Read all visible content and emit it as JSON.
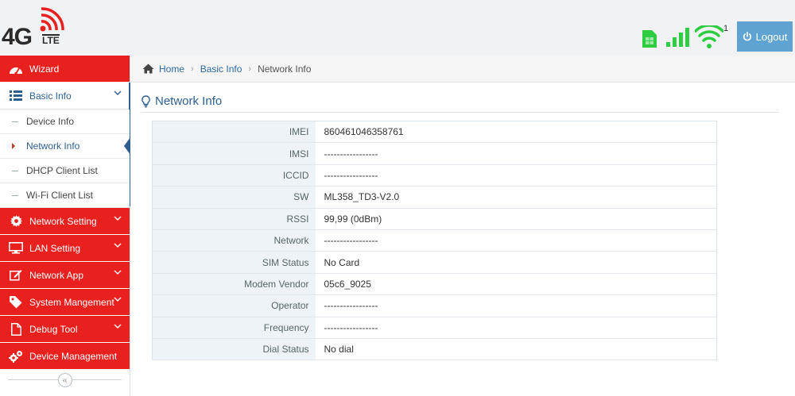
{
  "header": {
    "logo": {
      "text_4g": "4G",
      "text_lte": "LTE"
    },
    "wifi_clients": "1",
    "logout_label": "Logout",
    "colors": {
      "status_green": "#2ecc40",
      "logout_bg": "#5fa3d3",
      "brand_red": "#e8201e"
    }
  },
  "sidebar": {
    "items": [
      {
        "label": "Wizard",
        "icon": "dashboard-icon"
      },
      {
        "label": "Basic Info",
        "icon": "list-icon",
        "open": true,
        "subitems": [
          {
            "label": "Device Info"
          },
          {
            "label": "Network Info",
            "active": true
          },
          {
            "label": "DHCP Client List"
          },
          {
            "label": "Wi-Fi Client List"
          }
        ]
      },
      {
        "label": "Network Setting",
        "icon": "gear-icon"
      },
      {
        "label": "LAN Setting",
        "icon": "monitor-icon"
      },
      {
        "label": "Network App",
        "icon": "edit-icon"
      },
      {
        "label": "System Mangement",
        "icon": "tag-icon"
      },
      {
        "label": "Debug Tool",
        "icon": "file-icon"
      },
      {
        "label": "Device Management",
        "icon": "gears-icon"
      }
    ],
    "collapse_label": "«"
  },
  "breadcrumb": {
    "home": "Home",
    "section": "Basic Info",
    "current": "Network Info"
  },
  "page": {
    "title": "Network Info"
  },
  "network_info": {
    "rows": [
      {
        "label": "IMEI",
        "value": "860461046358761"
      },
      {
        "label": "IMSI",
        "value": "-----------------"
      },
      {
        "label": "ICCID",
        "value": "-----------------"
      },
      {
        "label": "SW",
        "value": "ML358_TD3-V2.0"
      },
      {
        "label": "RSSI",
        "value": "99,99 (0dBm)"
      },
      {
        "label": "Network",
        "value": "-----------------"
      },
      {
        "label": "SIM Status",
        "value": "No Card"
      },
      {
        "label": "Modem Vendor",
        "value": "05c6_9025"
      },
      {
        "label": "Operator",
        "value": "-----------------"
      },
      {
        "label": "Frequency",
        "value": "-----------------"
      },
      {
        "label": "Dial Status",
        "value": "No dial"
      }
    ]
  }
}
